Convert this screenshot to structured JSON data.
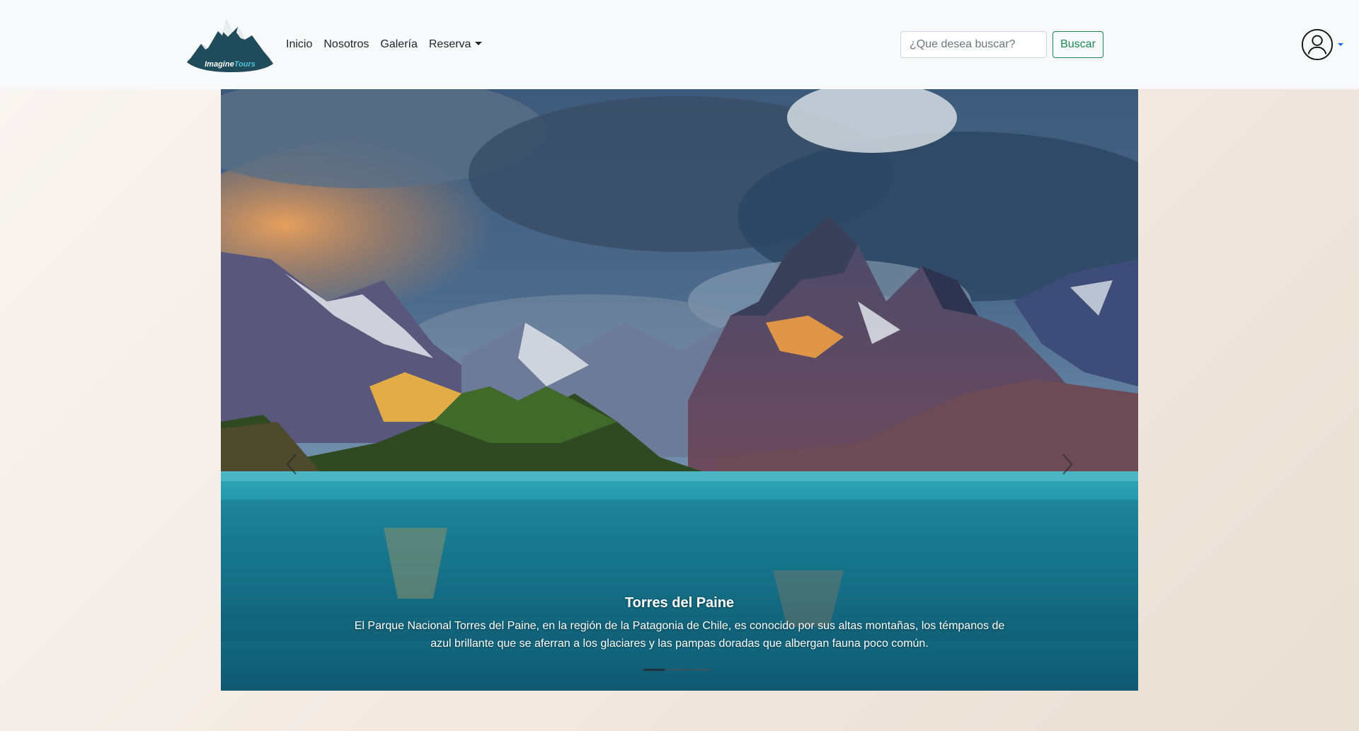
{
  "navbar": {
    "logo_text": "ImagineTours",
    "links": [
      "Inicio",
      "Nosotros",
      "Galería",
      "Reserva"
    ],
    "search": {
      "placeholder": "¿Que desea buscar?",
      "button_label": "Buscar"
    }
  },
  "carousel": {
    "slides": [
      {
        "title": "Torres del Paine",
        "description": "El Parque Nacional Torres del Paine, en la región de la Patagonia de Chile, es conocido por sus altas montañas, los témpanos de azul brillante que se aferran a los glaciares y las pampas doradas que albergan fauna poco común."
      }
    ],
    "active_index": 0,
    "indicator_count": 3
  },
  "colors": {
    "navbar_bg": "#f8f9fa",
    "success": "#198754",
    "primary": "#0d6efd",
    "lake": "#1b7f9a"
  },
  "icons": {
    "user": "person-circle-icon",
    "prev": "chevron-left-icon",
    "next": "chevron-right-icon"
  }
}
